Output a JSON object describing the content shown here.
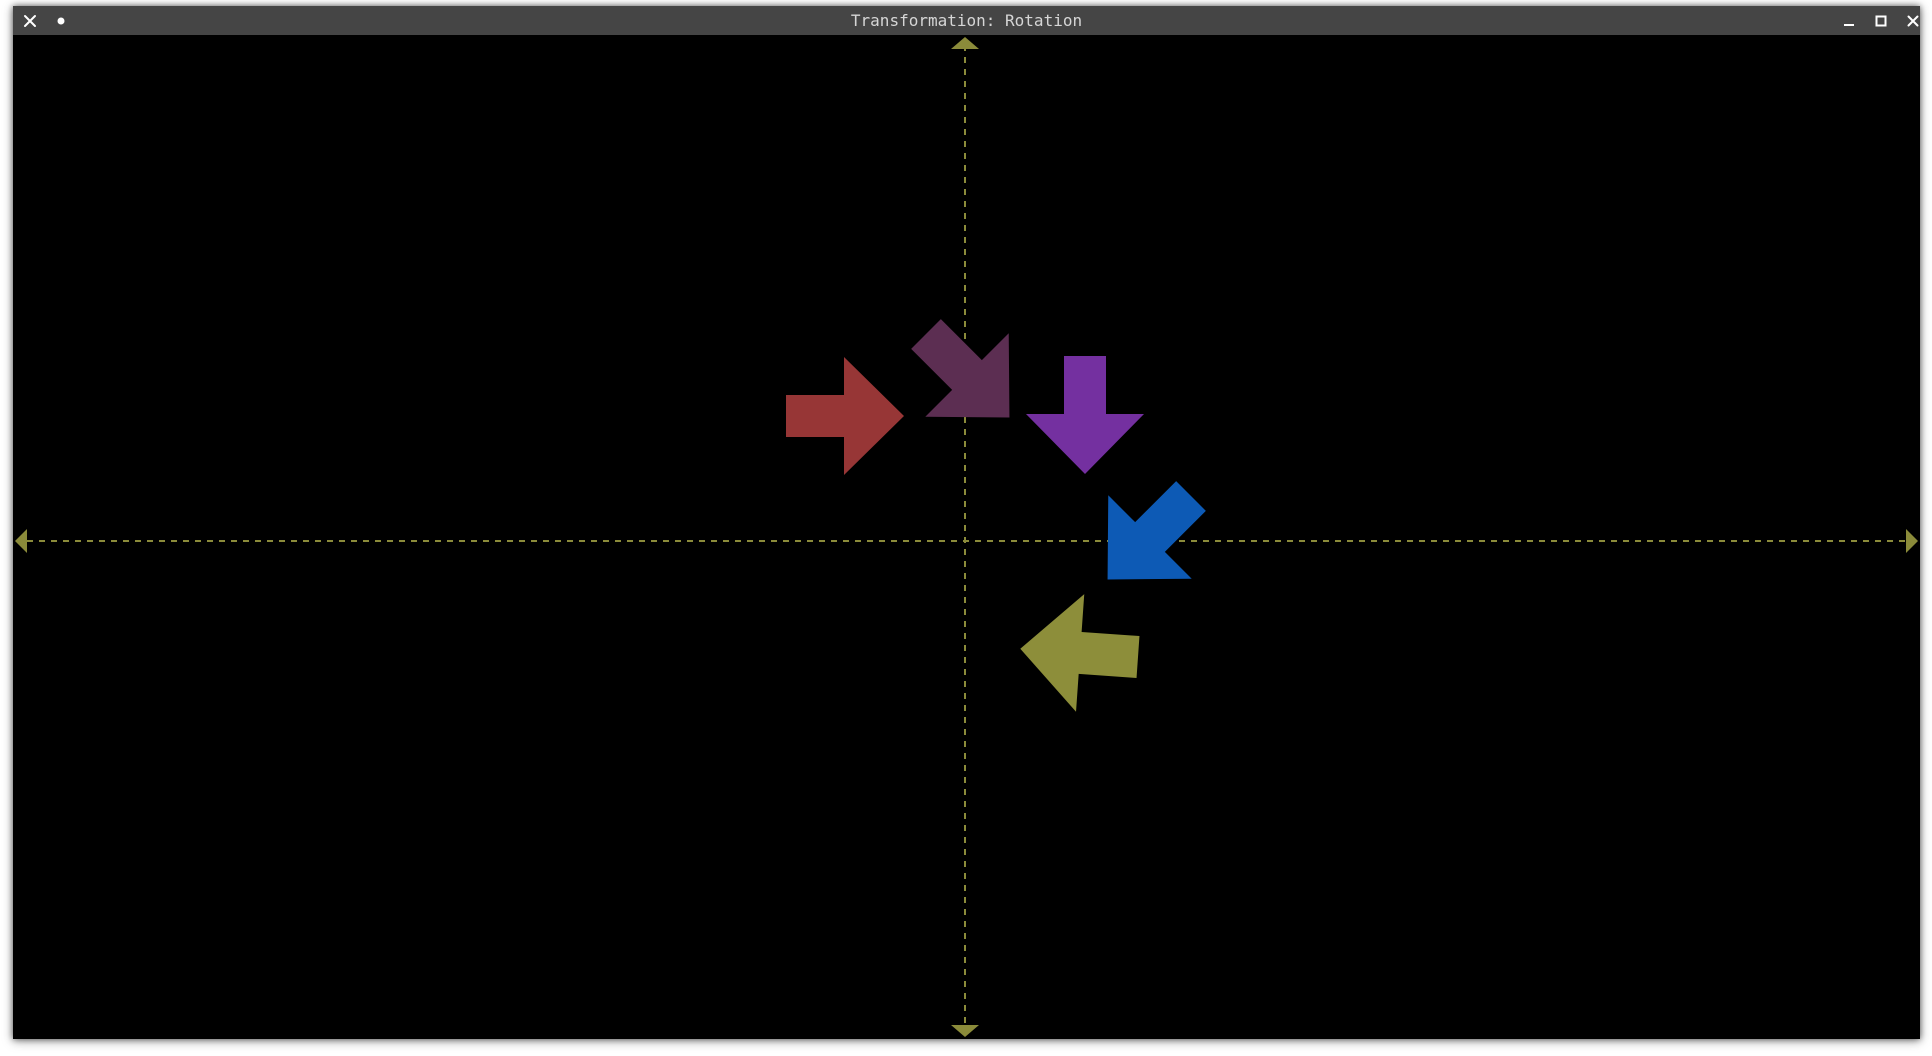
{
  "window": {
    "title": "Transformation: Rotation",
    "close_icon": "close-icon",
    "menu_icon": "dot-menu-icon",
    "minimize_icon": "minimize-icon",
    "maximize_icon": "maximize-icon",
    "close_right_icon": "close-icon"
  },
  "colors": {
    "titlebar": "#454545",
    "canvas_background": "#000000",
    "axes": "#8b8b3a",
    "arrow_red": "#973636",
    "arrow_maroon": "#5c2e52",
    "arrow_purple": "#7430a0",
    "arrow_blue": "#0d5ab5",
    "arrow_olive": "#8d8e3a"
  },
  "arrows": [
    {
      "name": "arrow-red",
      "rotation_deg": 0,
      "color": "#973636"
    },
    {
      "name": "arrow-maroon",
      "rotation_deg": 45,
      "color": "#5c2e52"
    },
    {
      "name": "arrow-purple",
      "rotation_deg": 90,
      "color": "#7430a0"
    },
    {
      "name": "arrow-blue",
      "rotation_deg": 135,
      "color": "#0d5ab5"
    },
    {
      "name": "arrow-olive",
      "rotation_deg": 184,
      "color": "#8d8e3a"
    }
  ]
}
